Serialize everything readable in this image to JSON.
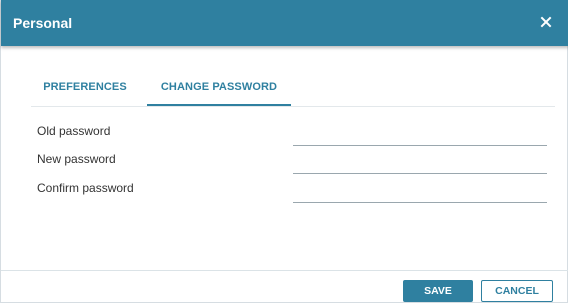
{
  "dialog": {
    "title": "Personal",
    "close_icon": "close-icon"
  },
  "tabs": [
    {
      "label": "PREFERENCES",
      "active": false
    },
    {
      "label": "CHANGE PASSWORD",
      "active": true
    }
  ],
  "form": {
    "old_password": {
      "label": "Old password",
      "value": ""
    },
    "new_password": {
      "label": "New password",
      "value": ""
    },
    "confirm_password": {
      "label": "Confirm password",
      "value": ""
    }
  },
  "footer": {
    "save_label": "SAVE",
    "cancel_label": "CANCEL"
  },
  "colors": {
    "accent": "#2f80a0",
    "title_text": "#ffffff",
    "label_text": "#333333"
  }
}
